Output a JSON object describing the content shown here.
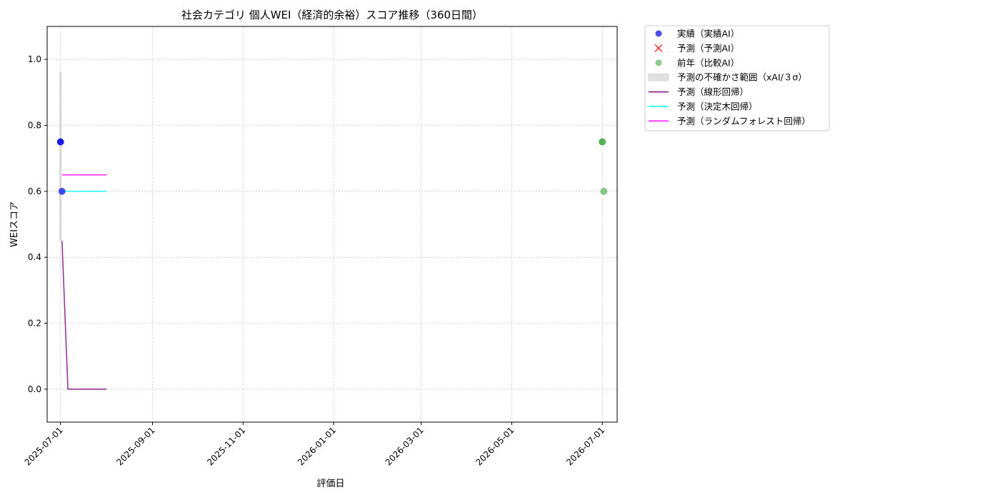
{
  "chart_data": {
    "type": "line",
    "title": "社会カテゴリ 個人WEI（経済的余裕）スコア推移（360日間）",
    "xlabel": "評価日",
    "ylabel": "WEIスコア",
    "xlim": [
      "2025-06-22",
      "2026-07-11"
    ],
    "ylim": [
      -0.1,
      1.1
    ],
    "x_ticks": [
      "2025-07-01",
      "2025-09-01",
      "2025-11-01",
      "2026-01-01",
      "2026-03-01",
      "2026-05-01",
      "2026-07-01"
    ],
    "y_ticks": [
      "0.0",
      "0.2",
      "0.4",
      "0.6",
      "0.8",
      "1.0"
    ],
    "grid": true,
    "legend_position": "outside-top-right",
    "series": [
      {
        "name": "実績（実績AI）",
        "kind": "scatter",
        "marker": "circle",
        "color": "#0000ff",
        "points": [
          {
            "x": "2025-07-01",
            "y": 0.75
          },
          {
            "x": "2025-07-01",
            "y": 0.75
          },
          {
            "x": "2025-07-02",
            "y": 0.6
          }
        ]
      },
      {
        "name": "予測（予測AI）",
        "kind": "scatter",
        "marker": "x",
        "color": "#ff0000",
        "points": []
      },
      {
        "name": "前年（比較AI）",
        "kind": "scatter",
        "marker": "circle",
        "color": "#2ca02c",
        "points": [
          {
            "x": "2026-07-01",
            "y": 0.75
          },
          {
            "x": "2026-07-01",
            "y": 0.75
          },
          {
            "x": "2026-07-02",
            "y": 0.6
          }
        ]
      },
      {
        "name": "予測の不確かさ範囲（xAI/３σ）",
        "kind": "band",
        "color": "#cccccc",
        "x": "2025-07-01",
        "y_low": 0.45,
        "y_high": 0.96
      },
      {
        "name": "予測（線形回帰）",
        "kind": "line",
        "color": "#800080",
        "points": [
          {
            "x": "2025-07-02",
            "y": 0.45
          },
          {
            "x": "2025-07-06",
            "y": 0.0
          },
          {
            "x": "2025-08-01",
            "y": 0.0
          }
        ]
      },
      {
        "name": "予測（決定木回帰）",
        "kind": "line",
        "color": "#00ffff",
        "points": [
          {
            "x": "2025-07-02",
            "y": 0.6
          },
          {
            "x": "2025-08-01",
            "y": 0.6
          }
        ]
      },
      {
        "name": "予測（ランダムフォレスト回帰）",
        "kind": "line",
        "color": "#ff00ff",
        "points": [
          {
            "x": "2025-07-02",
            "y": 0.65
          },
          {
            "x": "2025-08-01",
            "y": 0.65
          }
        ]
      }
    ]
  }
}
